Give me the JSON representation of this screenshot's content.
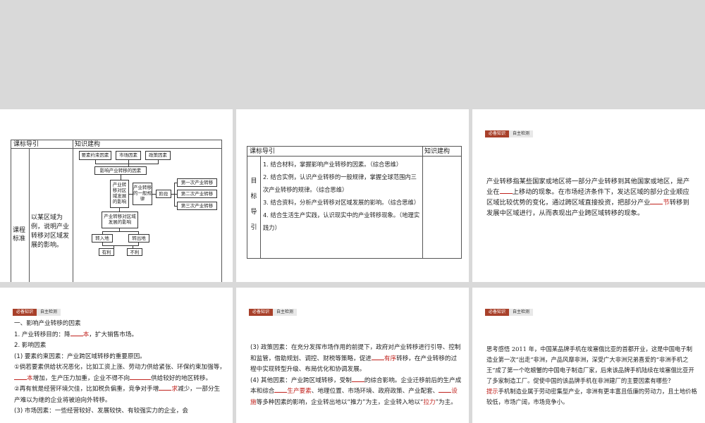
{
  "slide1": {
    "header_col1": "课标导引",
    "header_col2": "知识建构",
    "row_label": "课程标准",
    "row_text": "以某区域为例，说明产业转移对区域发展的影响。",
    "diagram": {
      "top_factors": [
        "要素约束因素",
        "市场因素",
        "政策因素"
      ],
      "influence": "影响产业转移的因素",
      "center": "产业转移对区域发展的影响",
      "law": "产业转移的一般规律",
      "stage": "阶段",
      "stages": [
        "第一次产业转移",
        "第二次产业转移",
        "第三次产业转移"
      ],
      "effect": "产业转移对区域发展的影响",
      "regions": [
        "转入地",
        "转出地"
      ],
      "outcomes": [
        "有利",
        "不利"
      ]
    }
  },
  "slide2": {
    "header_col1": "课标导引",
    "header_col2": "知识建构",
    "vertical": [
      "目",
      "标",
      "导",
      "引"
    ],
    "items": [
      "1. 结合材料，掌握影响产业转移的因素。（综合思维）",
      "2. 结合实例，认识产业转移的一般规律，掌握全球范围内三次产业转移的规律。（综合思维）",
      "3. 结合资料，分析产业转移对区域发展的影响。（综合思维）",
      "4. 结合生活生产实践，认识现实中的产业转移现象。（地理实践力）"
    ]
  },
  "tabs": {
    "active": "必备知识",
    "inactive": "自主检测"
  },
  "slide3": {
    "p1": "产业转移指某些国家或地区将一部分产业转移到其他国家或地区，是产业在",
    "p2": "上移动的现象。在市场经济条件下，发达区域的部分企业顺应区域比较优势的变化，通过跨区域直接投资，把部分产业",
    "p3": "节",
    "p4": "转移到发展中区域进行，从而表现出产业跨区域转移的现象。"
  },
  "slide4": {
    "heading": "一、影响产业转移的因素",
    "l1a": "1. 产业转移目的：降",
    "l1b": "本",
    "l1c": "，扩大销售市场。",
    "l2": "2. 影响因素",
    "l3": "(1) 要素约束因素：产业跨区域转移的重要原因。",
    "l4a": "①倘若要素供给状况恶化，比如工资上涨、劳动力供给紧张、环保约束加强等，",
    "l4b": "本",
    "l4c": "增加，生产压力加重，企业不得不向",
    "l4d": "供给较好的地区转移。",
    "l5a": "②再有就是经营环境欠佳，比如税负偏重，竞争对手增",
    "l5b": "求",
    "l5c": "减少，一部分生产难以为继的企业将被迫向外转移。",
    "l6": "(3) 市场因素：一些经营较好、发展较快、有较强实力的企业，会"
  },
  "slide5": {
    "l1": "(3) 政策因素：在充分发挥市场作用的前提下，政府对产业转移进行引导、控制和监管，借助规划、调控、财税等策略，促进",
    "l1r": "有序",
    "l1c": "转移，在产业转移的过程中实现转型升级、布局优化和协调发展。",
    "l2a": "(4) 其他因素：产业跨区域转移，受制",
    "l2b": "的综合影响。企业迁移前后的生产成本和综合",
    "l2c": "生产要素",
    "l2d": "、地理位置、市场环境、政府政策、产业配套、",
    "l2e": "设施",
    "l2f": "等多种因素的影响，企业转出地以“推力”为主，企业转入地以“",
    "l2g": "拉力",
    "l2h": "”为主。"
  },
  "slide6": {
    "think": "思考感悟 2011 年，中国某品牌手机在埃塞俄比亚的首都开业，这是中国电子制造业第一次“出走”非洲，产品风靡非洲，深受广大非洲兄弟喜爱的“非洲手机之王”成了第一个吃螃蟹的中国电子制造厂家，后来该品牌手机陆续在埃塞俄比亚开了多家制造工厂。促使中国的该品牌手机在非洲建厂的主要因素有哪些？",
    "hint_label": "提示",
    "hint": "手机制造业属于劳动密集型产业，非洲有更丰富且低廉的劳动力，且土地价格较低，市场广阔，市场竞争小。"
  }
}
